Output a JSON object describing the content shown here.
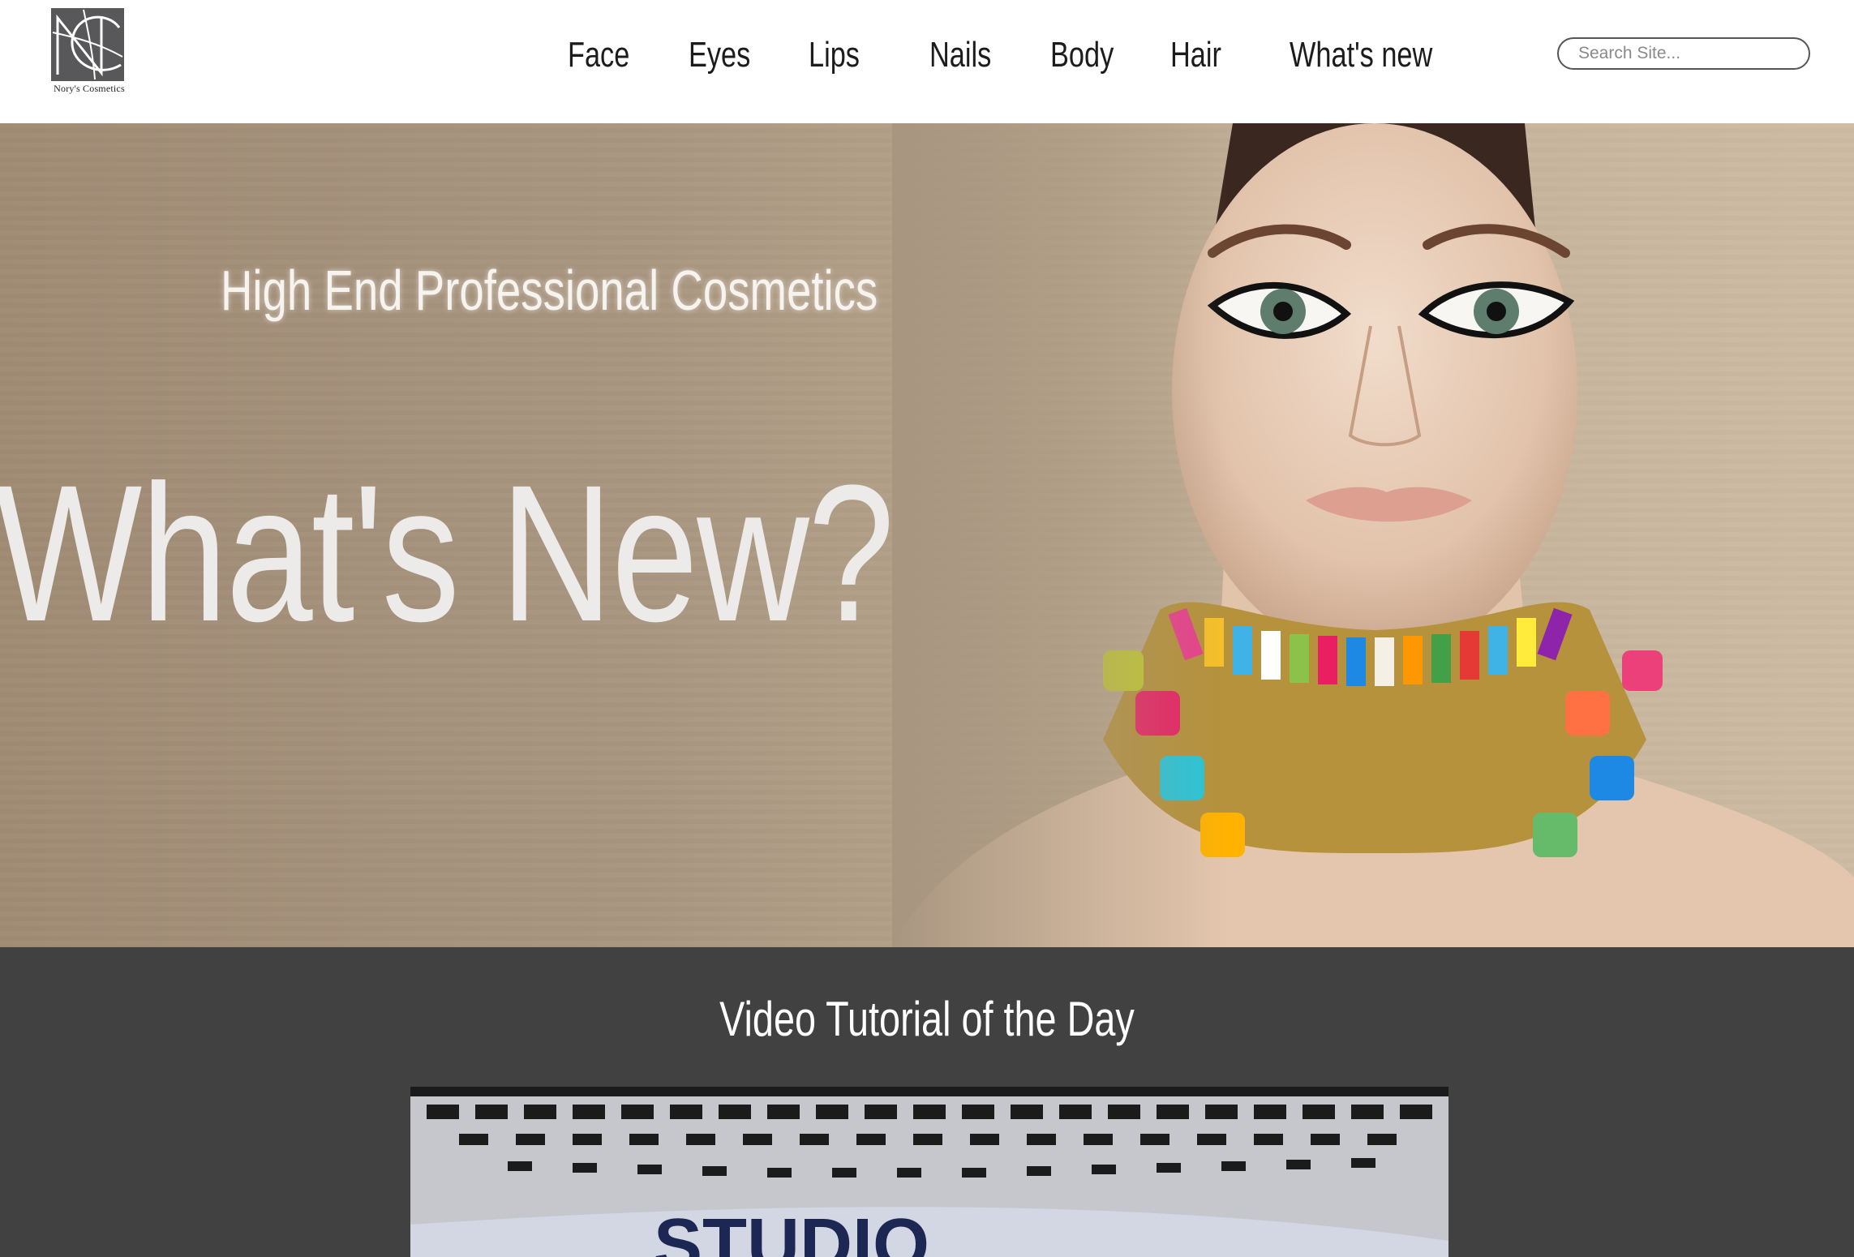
{
  "brand": {
    "logo_monogram": "NC",
    "logo_text": "Nory's Cosmetics"
  },
  "nav": {
    "items": [
      {
        "label": "Face"
      },
      {
        "label": "Eyes"
      },
      {
        "label": "Lips"
      },
      {
        "label": "Nails"
      },
      {
        "label": "Body"
      },
      {
        "label": "Hair"
      },
      {
        "label": "What's new"
      }
    ]
  },
  "search": {
    "placeholder": "Search Site...",
    "value": ""
  },
  "hero": {
    "subtitle": "High End Professional Cosmetics",
    "title": "What's New?",
    "image": "model-with-beaded-necklace"
  },
  "video": {
    "section_title": "Video Tutorial of the Day",
    "thumbnail": "building-video-thumbnail",
    "thumbnail_text": "STUDIO"
  },
  "colors": {
    "header_bg": "#ffffff",
    "hero_bg": "#a99680",
    "video_section_bg": "#414141",
    "text_light": "#ffffff"
  }
}
